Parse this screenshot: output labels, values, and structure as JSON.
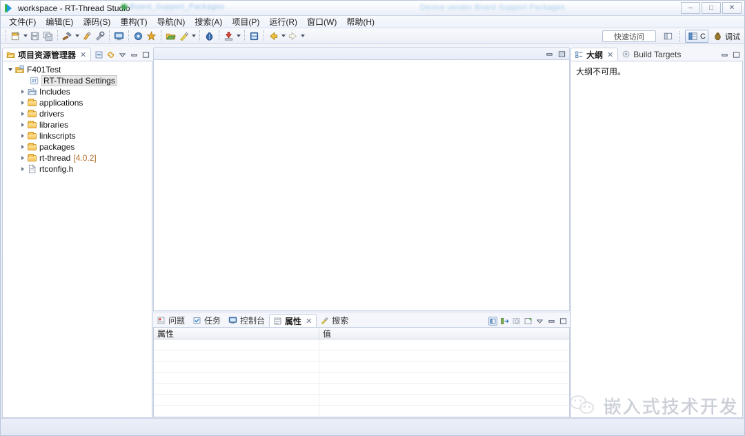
{
  "window": {
    "title": "workspace - RT-Thread Studio",
    "app_icon": "rtthread-logo-icon",
    "watermark_left": "Board_Support_Packages",
    "watermark_right": "Device vendor Board Support Packages",
    "controls": [
      {
        "name": "minimize-button",
        "glyph": "–"
      },
      {
        "name": "maximize-button",
        "glyph": "□"
      },
      {
        "name": "close-button",
        "glyph": "✕"
      }
    ]
  },
  "menubar": {
    "items": [
      {
        "label": "文件(F)",
        "name": "menu-file"
      },
      {
        "label": "编辑(E)",
        "name": "menu-edit"
      },
      {
        "label": "源码(S)",
        "name": "menu-source"
      },
      {
        "label": "重构(T)",
        "name": "menu-refactor"
      },
      {
        "label": "导航(N)",
        "name": "menu-navigate"
      },
      {
        "label": "搜索(A)",
        "name": "menu-search"
      },
      {
        "label": "项目(P)",
        "name": "menu-project"
      },
      {
        "label": "运行(R)",
        "name": "menu-run"
      },
      {
        "label": "窗口(W)",
        "name": "menu-window"
      },
      {
        "label": "帮助(H)",
        "name": "menu-help"
      }
    ]
  },
  "toolbar": {
    "quick_access_label": "快速访问",
    "perspective_c_label": "C",
    "perspective_debug_label": "调试",
    "buttons": [
      {
        "name": "new-button",
        "icon": "new-file-icon",
        "dropdown": true
      },
      {
        "name": "save-button",
        "icon": "save-icon",
        "dropdown": false
      },
      {
        "name": "save-all-button",
        "icon": "save-all-icon",
        "dropdown": false
      },
      {
        "name": "build-button",
        "icon": "hammer-icon",
        "dropdown": true
      },
      {
        "name": "clean-button",
        "icon": "clean-icon",
        "dropdown": false
      },
      {
        "name": "configure-button",
        "icon": "wrench-icon",
        "dropdown": false
      },
      {
        "name": "terminal-button",
        "icon": "terminal-icon",
        "dropdown": false
      },
      {
        "name": "flash-button",
        "icon": "chip-icon",
        "dropdown": false
      },
      {
        "name": "sdk-manager-button",
        "icon": "star-icon",
        "dropdown": false
      },
      {
        "name": "open-package-button",
        "icon": "package-icon",
        "dropdown": false
      },
      {
        "name": "run-button",
        "icon": "run-icon",
        "dropdown": true
      },
      {
        "name": "debug-button",
        "icon": "bug-icon",
        "dropdown": false
      },
      {
        "name": "download-button",
        "icon": "download-icon",
        "dropdown": true
      },
      {
        "name": "resource-button",
        "icon": "resource-icon",
        "dropdown": false
      },
      {
        "name": "back-button",
        "icon": "arrow-left-icon",
        "dropdown": true
      },
      {
        "name": "forward-button",
        "icon": "arrow-right-icon",
        "dropdown": true
      }
    ]
  },
  "project_explorer": {
    "tab_label": "项目资源管理器",
    "tab_icon": "project-explorer-icon",
    "close_glyph": "✕",
    "tools": [
      {
        "name": "collapse-all-icon"
      },
      {
        "name": "link-with-editor-icon"
      },
      {
        "name": "view-menu-icon"
      },
      {
        "name": "minimize-view-icon"
      },
      {
        "name": "maximize-view-icon"
      }
    ],
    "tree": [
      {
        "label": "F401Test",
        "icon": "project-icon",
        "indent": 0,
        "twist": "open",
        "selected": false,
        "version": ""
      },
      {
        "label": "RT-Thread Settings",
        "icon": "rtthread-settings-icon",
        "indent": 1,
        "twist": "none",
        "selected": true,
        "version": ""
      },
      {
        "label": "Includes",
        "icon": "includes-icon",
        "indent": 1,
        "twist": "closed",
        "selected": false,
        "version": ""
      },
      {
        "label": "applications",
        "icon": "folder-icon",
        "indent": 1,
        "twist": "closed",
        "selected": false,
        "version": ""
      },
      {
        "label": "drivers",
        "icon": "folder-icon",
        "indent": 1,
        "twist": "closed",
        "selected": false,
        "version": ""
      },
      {
        "label": "libraries",
        "icon": "folder-icon",
        "indent": 1,
        "twist": "closed",
        "selected": false,
        "version": ""
      },
      {
        "label": "linkscripts",
        "icon": "folder-icon",
        "indent": 1,
        "twist": "closed",
        "selected": false,
        "version": ""
      },
      {
        "label": "packages",
        "icon": "folder-icon",
        "indent": 1,
        "twist": "closed",
        "selected": false,
        "version": ""
      },
      {
        "label": "rt-thread",
        "icon": "folder-icon",
        "indent": 1,
        "twist": "closed",
        "selected": false,
        "version": "[4.0.2]"
      },
      {
        "label": "rtconfig.h",
        "icon": "header-file-icon",
        "indent": 1,
        "twist": "closed",
        "selected": false,
        "version": ""
      }
    ]
  },
  "editor_area": {
    "content": "",
    "tools": [
      {
        "name": "minimize-editor-icon"
      },
      {
        "name": "maximize-editor-icon"
      }
    ]
  },
  "bottom_panel": {
    "tabs": [
      {
        "label": "问题",
        "name": "tab-problems",
        "icon": "problems-icon",
        "active": false
      },
      {
        "label": "任务",
        "name": "tab-tasks",
        "icon": "tasks-icon",
        "active": false
      },
      {
        "label": "控制台",
        "name": "tab-console",
        "icon": "console-icon",
        "active": false
      },
      {
        "label": "属性",
        "name": "tab-properties",
        "icon": "properties-icon",
        "active": true
      },
      {
        "label": "搜索",
        "name": "tab-search",
        "icon": "search-icon",
        "active": false
      }
    ],
    "close_glyph": "✕",
    "tools": [
      {
        "name": "show-categories-icon"
      },
      {
        "name": "show-advanced-icon"
      },
      {
        "name": "restore-default-icon"
      },
      {
        "name": "pin-to-selection-icon"
      },
      {
        "name": "view-menu-icon"
      },
      {
        "name": "minimize-view-icon"
      },
      {
        "name": "maximize-view-icon"
      }
    ],
    "properties_table": {
      "columns": [
        "属性",
        "值"
      ],
      "rows": [],
      "empty_row_count": 8
    }
  },
  "outline_panel": {
    "tabs": [
      {
        "label": "大纲",
        "name": "tab-outline",
        "icon": "outline-icon",
        "active": true
      },
      {
        "label": "Build Targets",
        "name": "tab-build-targets",
        "icon": "build-targets-icon",
        "active": false
      }
    ],
    "close_glyph": "✕",
    "message": "大纲不可用。",
    "tools": [
      {
        "name": "minimize-view-icon"
      },
      {
        "name": "maximize-view-icon"
      }
    ]
  },
  "statusbar": {
    "text": ""
  },
  "overlay_watermark": {
    "text": "嵌入式技术开发",
    "icon": "wechat-icon"
  },
  "colors": {
    "accent": "#1a9be0",
    "folder": "#f3c257",
    "selection": "#e8e8e8",
    "version_text": "#b06c2a",
    "panel_bg": "#f4f6fb"
  }
}
